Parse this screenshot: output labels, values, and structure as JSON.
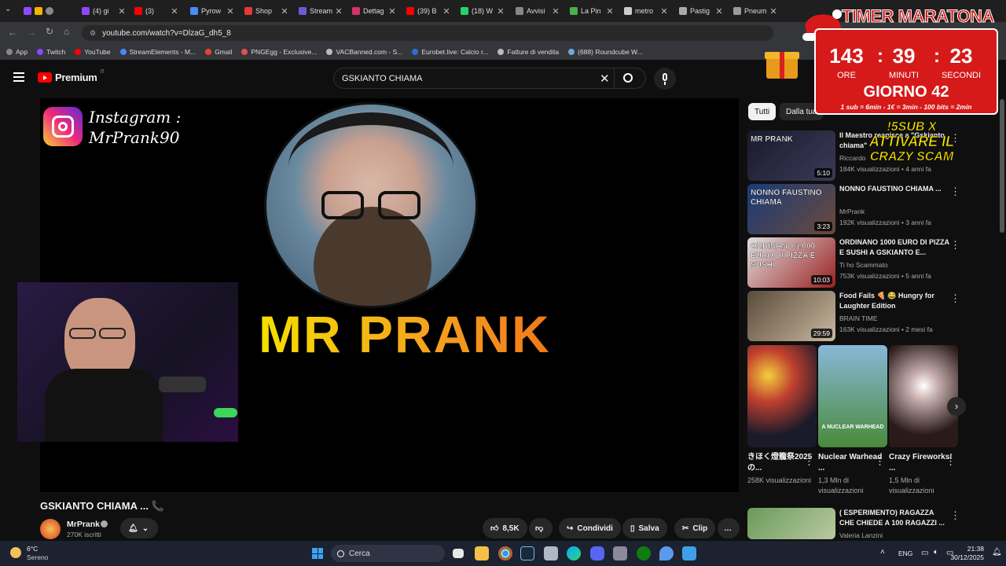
{
  "browser": {
    "tabs": [
      {
        "label": "(4) gi",
        "color": "#9146ff"
      },
      {
        "label": "(3)",
        "color": "#ff0000"
      },
      {
        "label": "Pyrow",
        "color": "#4a8af4"
      },
      {
        "label": "Shop",
        "color": "#e03a3a"
      },
      {
        "label": "Stream",
        "color": "#6b5bd6"
      },
      {
        "label": "Dettag",
        "color": "#d6336c"
      },
      {
        "label": "(39) B",
        "color": "#ff0000"
      },
      {
        "label": "(18) W",
        "color": "#25d366"
      },
      {
        "label": "Avvisi",
        "color": "#888888"
      },
      {
        "label": "La Pin",
        "color": "#4caf50"
      },
      {
        "label": "metro",
        "color": "#cccccc"
      },
      {
        "label": "Pastig",
        "color": "#aaaaaa"
      },
      {
        "label": "Pneum",
        "color": "#999999"
      }
    ],
    "url": "youtube.com/watch?v=DlzaG_dh5_8",
    "bookmarks": [
      {
        "label": "App",
        "color": "#888888"
      },
      {
        "label": "Twitch",
        "color": "#9146ff"
      },
      {
        "label": "YouTube",
        "color": "#ff0000"
      },
      {
        "label": "StreamElements - M...",
        "color": "#4a8af4"
      },
      {
        "label": "Gmail",
        "color": "#ea4335"
      },
      {
        "label": "PNGEgg - Exclusive...",
        "color": "#e05050"
      },
      {
        "label": "VACBanned.com - S...",
        "color": "#bbbbbb"
      },
      {
        "label": "Eurobet.live: Calcio r...",
        "color": "#2b6fd6"
      },
      {
        "label": "Fatture di vendita",
        "color": "#bbbbbb"
      },
      {
        "label": "(688) Roundcube W...",
        "color": "#6fa8dc"
      }
    ]
  },
  "youtube": {
    "logo": "Premium",
    "logo_region": "IT",
    "search_value": "GSKIANTO CHIAMA",
    "chips": [
      "Tutti",
      "Dalla tua"
    ],
    "video": {
      "instagram_text_line1": "Instagram :",
      "instagram_text_line2": "MrPrank90",
      "overlay_title": "MR PRANK",
      "title": "GSKIANTO CHIAMA ...",
      "channel": "MrPrank",
      "subscribers": "270K iscritti",
      "likes": "8,5K",
      "share_label": "Condividi",
      "save_label": "Salva",
      "clip_label": "Clip"
    },
    "recommendations": [
      {
        "title": "Il Maestro reagisce a \"Gskianto chiama\"",
        "channel": "Riccardo",
        "meta": "184K visualizzazioni • 4 anni fa",
        "duration": "5:10",
        "thumb_text": "MR PRANK"
      },
      {
        "title": "NONNO FAUSTINO CHIAMA ...",
        "channel": "MrPrank",
        "meta": "192K visualizzazioni • 3 anni fa",
        "duration": "3:23",
        "thumb_text": "NONNO FAUSTINO CHIAMA"
      },
      {
        "title": "ORDINANO 1000 EURO DI PIZZA E SUSHI A GSKIANTO E...",
        "channel": "Ti ho Scammato",
        "meta": "753K visualizzazioni • 5 anni fa",
        "duration": "10:03",
        "thumb_text": "ORDINANO 1.000 EURO DI PIZZA E SUSHI"
      },
      {
        "title": "Food Fails 🍕 😂 Hungry for Laughter Edition",
        "channel": "BRAIN TIME",
        "meta": "163K visualizzazioni • 2 mesi fa",
        "duration": "29:59",
        "thumb_text": ""
      }
    ],
    "shorts": [
      {
        "title": "きほく燈籠祭2025の...",
        "views": "258K visualizzazioni",
        "thumb_text": ""
      },
      {
        "title": "Nuclear Warhead ...",
        "views": "1,3 Mln di visualizzazioni",
        "thumb_text": "A NUCLEAR WARHEAD"
      },
      {
        "title": "Crazy Fireworks! ...",
        "views": "1,5 Mln di visualizzazioni",
        "thumb_text": ""
      }
    ],
    "last_rec": {
      "title": "( ESPERIMENTO) RAGAZZA CHE CHIEDE A 100 RAGAZZI ...",
      "channel": "Valeria Lanzini"
    }
  },
  "overlay": {
    "timer_title": "TIMER MARATONA",
    "hours": "143",
    "minutes": "39",
    "seconds": "23",
    "hours_label": "ORE",
    "minutes_label": "MINUTI",
    "seconds_label": "SECONDI",
    "day": "GIORNO 42",
    "rates": "1 sub = 6min - 1€ = 3min - 100 bits = 2min",
    "scam_line1": "!5SUB X",
    "scam_line2": "ATTIVARE IL",
    "scam_line3": "CRAZY SCAM"
  },
  "taskbar": {
    "weather_temp": "6°C",
    "weather_desc": "Sereno",
    "search_placeholder": "Cerca",
    "lang": "ENG",
    "time": "21:38",
    "date": "30/12/2025"
  }
}
